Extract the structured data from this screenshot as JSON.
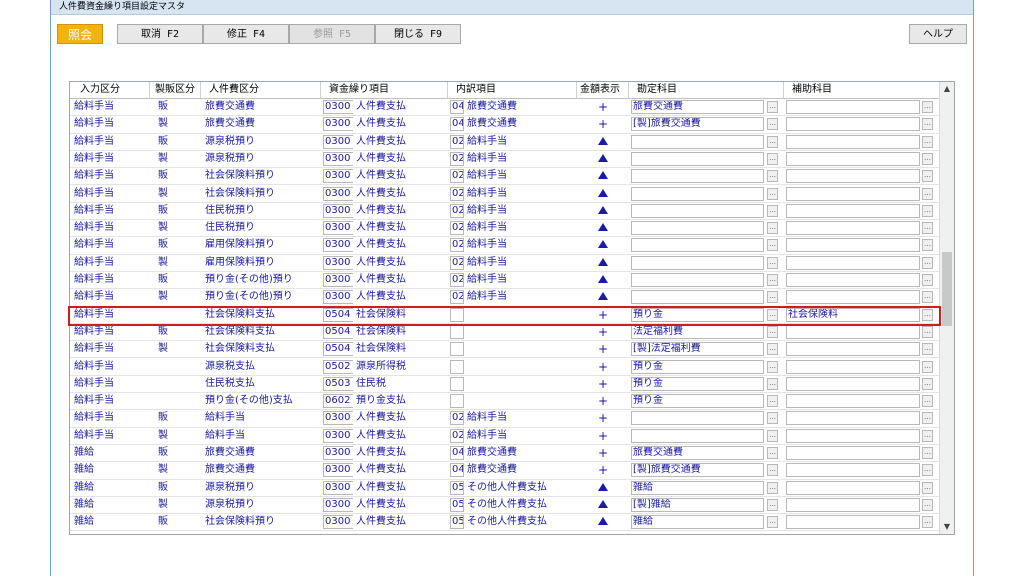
{
  "window": {
    "title": "人件費資金繰り項目設定マスタ"
  },
  "toolbar": {
    "mode_label": "照会",
    "cancel_label": "取消 F2",
    "edit_label": "修正 F4",
    "ref_label": "参照 F5",
    "close_label": "閉じる F9",
    "help_label": "ヘルプ"
  },
  "columns": [
    "入力区分",
    "製販区分",
    "人件費区分",
    "資金繰り項目",
    "内訳項目",
    "金額表示",
    "勘定科目",
    "補助科目"
  ],
  "rows": [
    {
      "input": "給料手当",
      "seihan": "販",
      "jinken": "旅費交通費",
      "sk_code": "0300",
      "sk_name": "人件費支払",
      "uc_code": "04",
      "uc_name": "旅費交通費",
      "amt": "+",
      "kanjo": "旅費交通費",
      "hojo": ""
    },
    {
      "input": "給料手当",
      "seihan": "製",
      "jinken": "旅費交通費",
      "sk_code": "0300",
      "sk_name": "人件費支払",
      "uc_code": "04",
      "uc_name": "旅費交通費",
      "amt": "+",
      "kanjo": "[製]旅費交通費",
      "hojo": ""
    },
    {
      "input": "給料手当",
      "seihan": "販",
      "jinken": "源泉税預り",
      "sk_code": "0300",
      "sk_name": "人件費支払",
      "uc_code": "02",
      "uc_name": "給料手当",
      "amt": "▲",
      "kanjo": "",
      "hojo": ""
    },
    {
      "input": "給料手当",
      "seihan": "製",
      "jinken": "源泉税預り",
      "sk_code": "0300",
      "sk_name": "人件費支払",
      "uc_code": "02",
      "uc_name": "給料手当",
      "amt": "▲",
      "kanjo": "",
      "hojo": ""
    },
    {
      "input": "給料手当",
      "seihan": "販",
      "jinken": "社会保険料預り",
      "sk_code": "0300",
      "sk_name": "人件費支払",
      "uc_code": "02",
      "uc_name": "給料手当",
      "amt": "▲",
      "kanjo": "",
      "hojo": ""
    },
    {
      "input": "給料手当",
      "seihan": "製",
      "jinken": "社会保険料預り",
      "sk_code": "0300",
      "sk_name": "人件費支払",
      "uc_code": "02",
      "uc_name": "給料手当",
      "amt": "▲",
      "kanjo": "",
      "hojo": ""
    },
    {
      "input": "給料手当",
      "seihan": "販",
      "jinken": "住民税預り",
      "sk_code": "0300",
      "sk_name": "人件費支払",
      "uc_code": "02",
      "uc_name": "給料手当",
      "amt": "▲",
      "kanjo": "",
      "hojo": ""
    },
    {
      "input": "給料手当",
      "seihan": "製",
      "jinken": "住民税預り",
      "sk_code": "0300",
      "sk_name": "人件費支払",
      "uc_code": "02",
      "uc_name": "給料手当",
      "amt": "▲",
      "kanjo": "",
      "hojo": ""
    },
    {
      "input": "給料手当",
      "seihan": "販",
      "jinken": "雇用保険料預り",
      "sk_code": "0300",
      "sk_name": "人件費支払",
      "uc_code": "02",
      "uc_name": "給料手当",
      "amt": "▲",
      "kanjo": "",
      "hojo": ""
    },
    {
      "input": "給料手当",
      "seihan": "製",
      "jinken": "雇用保険料預り",
      "sk_code": "0300",
      "sk_name": "人件費支払",
      "uc_code": "02",
      "uc_name": "給料手当",
      "amt": "▲",
      "kanjo": "",
      "hojo": ""
    },
    {
      "input": "給料手当",
      "seihan": "販",
      "jinken": "預り金(その他)預り",
      "sk_code": "0300",
      "sk_name": "人件費支払",
      "uc_code": "02",
      "uc_name": "給料手当",
      "amt": "▲",
      "kanjo": "",
      "hojo": ""
    },
    {
      "input": "給料手当",
      "seihan": "製",
      "jinken": "預り金(その他)預り",
      "sk_code": "0300",
      "sk_name": "人件費支払",
      "uc_code": "02",
      "uc_name": "給料手当",
      "amt": "▲",
      "kanjo": "",
      "hojo": ""
    },
    {
      "input": "給料手当",
      "seihan": "",
      "jinken": "社会保険料支払",
      "sk_code": "0504",
      "sk_name": "社会保険料",
      "uc_code": "",
      "uc_name": "",
      "amt": "+",
      "kanjo": "預り金",
      "hojo": "社会保険料"
    },
    {
      "input": "給料手当",
      "seihan": "販",
      "jinken": "社会保険料支払",
      "sk_code": "0504",
      "sk_name": "社会保険料",
      "uc_code": "",
      "uc_name": "",
      "amt": "+",
      "kanjo": "法定福利費",
      "hojo": ""
    },
    {
      "input": "給料手当",
      "seihan": "製",
      "jinken": "社会保険料支払",
      "sk_code": "0504",
      "sk_name": "社会保険料",
      "uc_code": "",
      "uc_name": "",
      "amt": "+",
      "kanjo": "[製]法定福利費",
      "hojo": ""
    },
    {
      "input": "給料手当",
      "seihan": "",
      "jinken": "源泉税支払",
      "sk_code": "0502",
      "sk_name": "源泉所得税",
      "uc_code": "",
      "uc_name": "",
      "amt": "+",
      "kanjo": "預り金",
      "hojo": ""
    },
    {
      "input": "給料手当",
      "seihan": "",
      "jinken": "住民税支払",
      "sk_code": "0503",
      "sk_name": "住民税",
      "uc_code": "",
      "uc_name": "",
      "amt": "+",
      "kanjo": "預り金",
      "hojo": ""
    },
    {
      "input": "給料手当",
      "seihan": "",
      "jinken": "預り金(その他)支払",
      "sk_code": "0602",
      "sk_name": "預り金支払",
      "uc_code": "",
      "uc_name": "",
      "amt": "+",
      "kanjo": "預り金",
      "hojo": ""
    },
    {
      "input": "給料手当",
      "seihan": "販",
      "jinken": "給料手当",
      "sk_code": "0300",
      "sk_name": "人件費支払",
      "uc_code": "02",
      "uc_name": "給料手当",
      "amt": "+",
      "kanjo": "",
      "hojo": ""
    },
    {
      "input": "給料手当",
      "seihan": "製",
      "jinken": "給料手当",
      "sk_code": "0300",
      "sk_name": "人件費支払",
      "uc_code": "02",
      "uc_name": "給料手当",
      "amt": "+",
      "kanjo": "",
      "hojo": ""
    },
    {
      "input": "雑給",
      "seihan": "販",
      "jinken": "旅費交通費",
      "sk_code": "0300",
      "sk_name": "人件費支払",
      "uc_code": "04",
      "uc_name": "旅費交通費",
      "amt": "+",
      "kanjo": "旅費交通費",
      "hojo": ""
    },
    {
      "input": "雑給",
      "seihan": "製",
      "jinken": "旅費交通費",
      "sk_code": "0300",
      "sk_name": "人件費支払",
      "uc_code": "04",
      "uc_name": "旅費交通費",
      "amt": "+",
      "kanjo": "[製]旅費交通費",
      "hojo": ""
    },
    {
      "input": "雑給",
      "seihan": "販",
      "jinken": "源泉税預り",
      "sk_code": "0300",
      "sk_name": "人件費支払",
      "uc_code": "05",
      "uc_name": "その他人件費支払",
      "amt": "▲",
      "kanjo": "雑給",
      "hojo": ""
    },
    {
      "input": "雑給",
      "seihan": "製",
      "jinken": "源泉税預り",
      "sk_code": "0300",
      "sk_name": "人件費支払",
      "uc_code": "05",
      "uc_name": "その他人件費支払",
      "amt": "▲",
      "kanjo": "[製]雑給",
      "hojo": ""
    },
    {
      "input": "雑給",
      "seihan": "販",
      "jinken": "社会保険料預り",
      "sk_code": "0300",
      "sk_name": "人件費支払",
      "uc_code": "05",
      "uc_name": "その他人件費支払",
      "amt": "▲",
      "kanjo": "雑給",
      "hojo": ""
    }
  ],
  "scroll": {
    "up_icon": "scroll-up-icon",
    "down_icon": "scroll-down-icon"
  },
  "colors": {
    "mode": "#f2b30d",
    "text": "#1a1a9c",
    "highlight": "#d01c1c"
  }
}
